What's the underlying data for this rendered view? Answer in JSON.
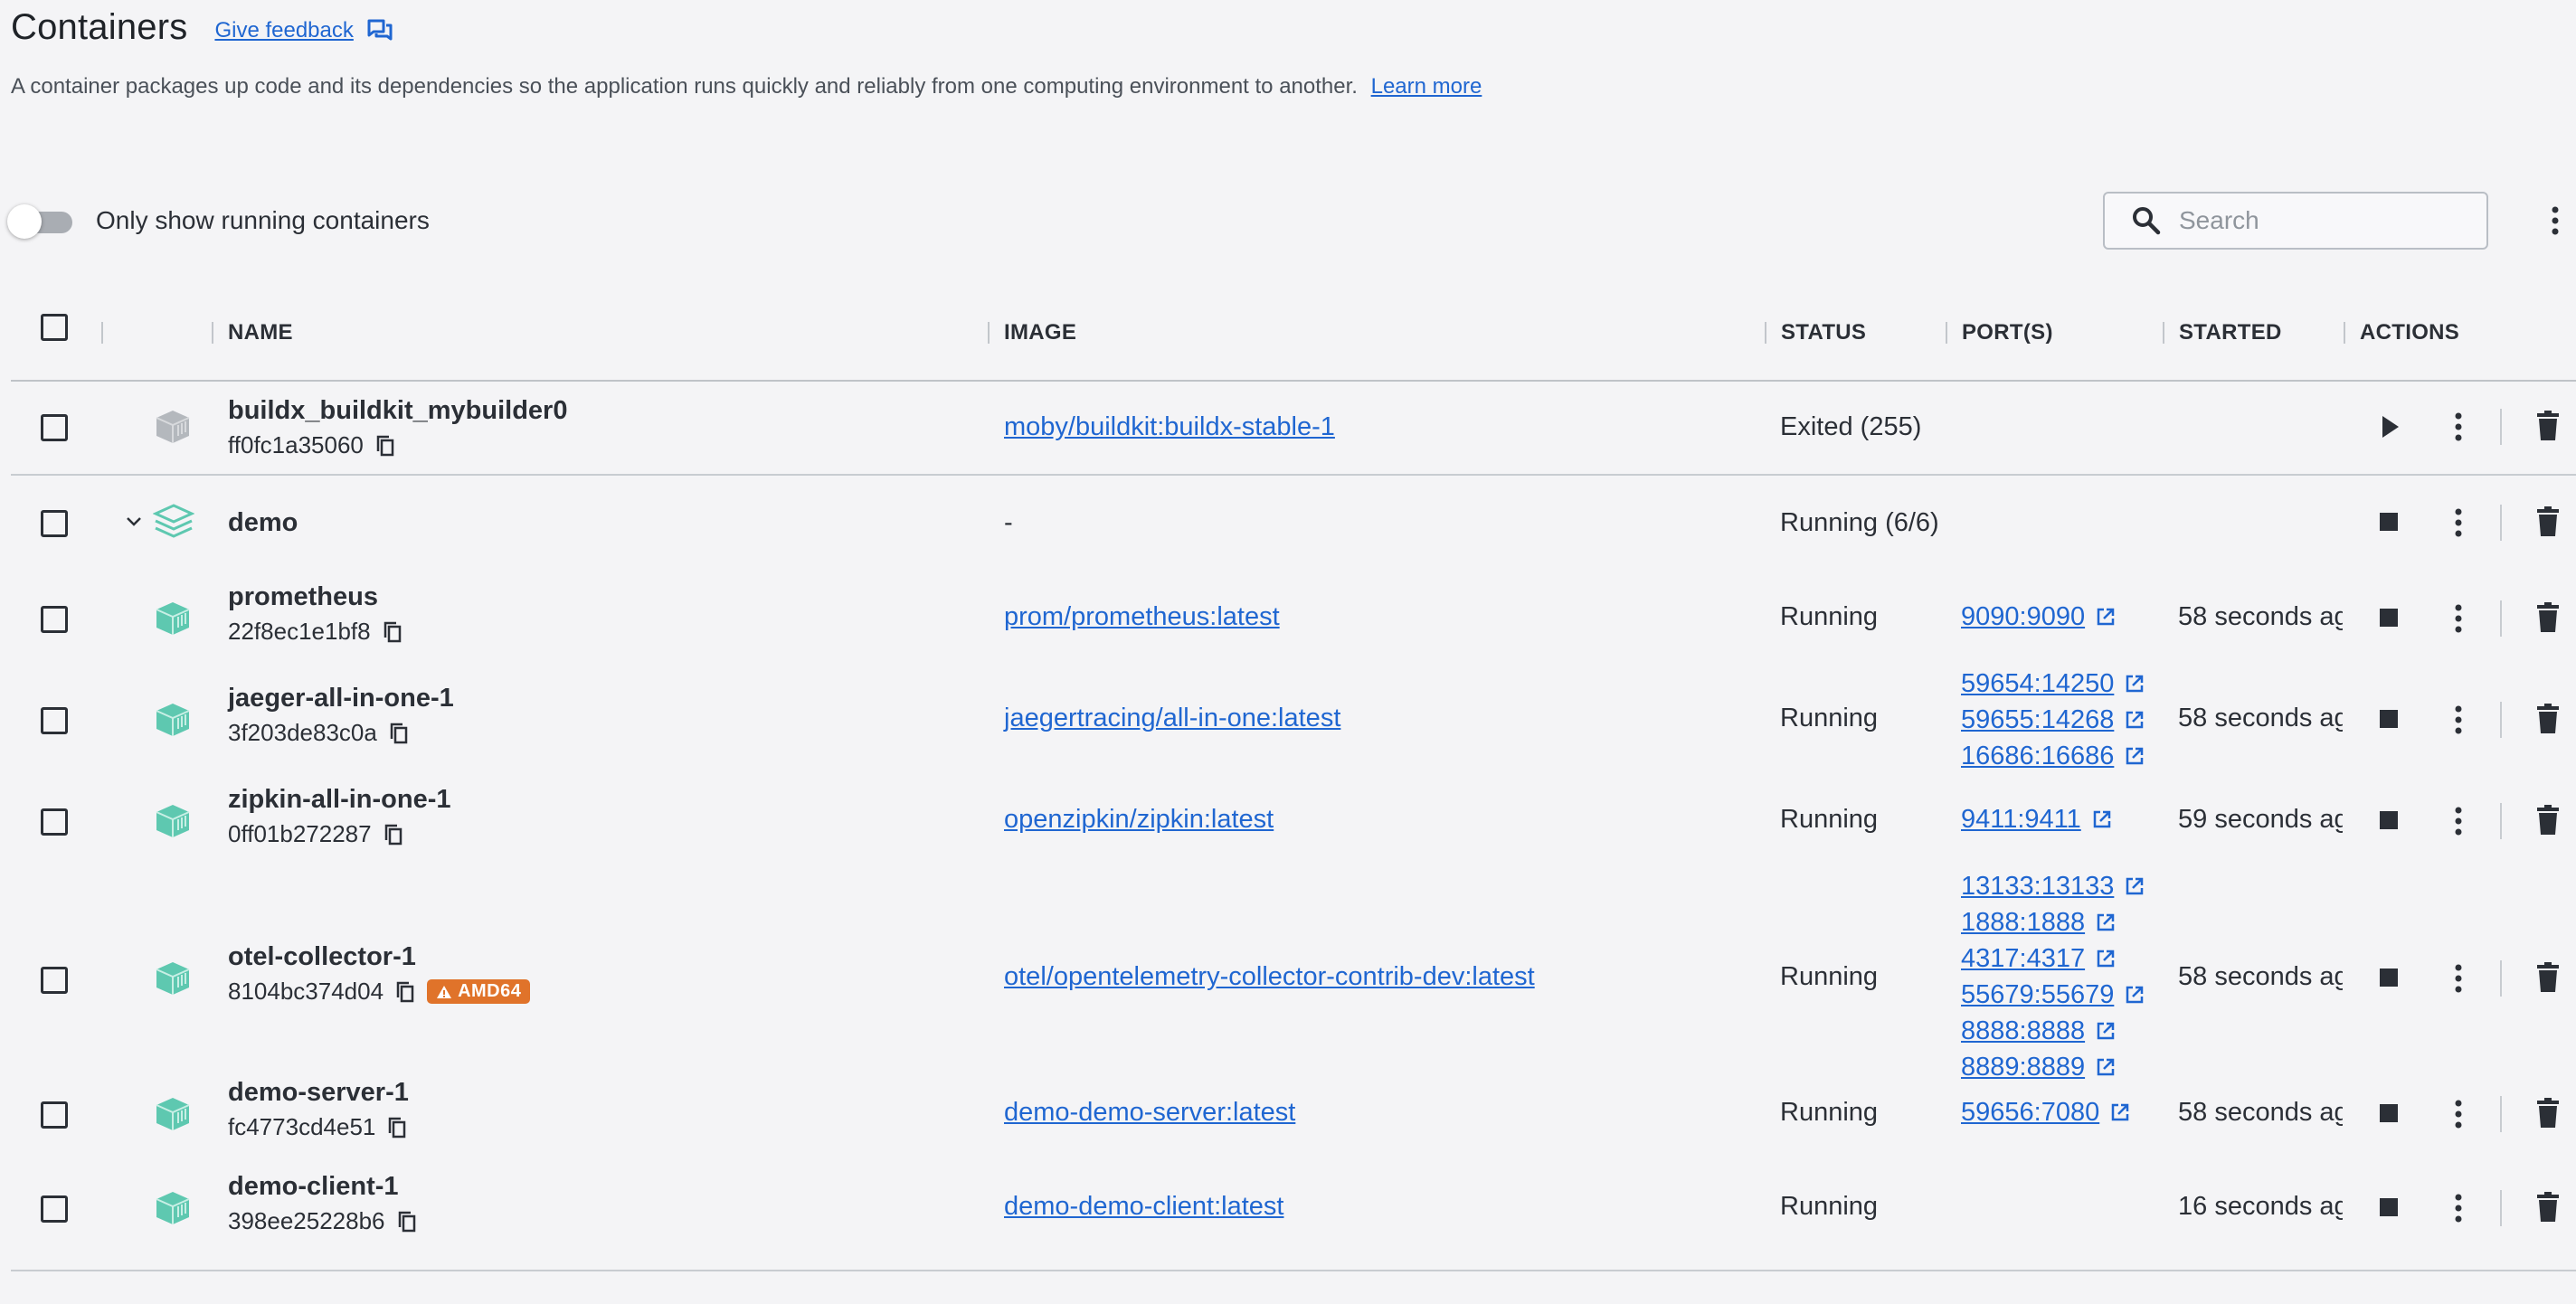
{
  "header": {
    "title": "Containers",
    "feedback_label": "Give feedback",
    "description": "A container packages up code and its dependencies so the application runs quickly and reliably from one computing environment to another.",
    "learn_more_label": "Learn more"
  },
  "toolbar": {
    "toggle_label": "Only show running containers",
    "toggle_on": false,
    "search_placeholder": "Search"
  },
  "columns": {
    "name": "NAME",
    "image": "IMAGE",
    "status": "STATUS",
    "ports": "PORT(S)",
    "started": "STARTED",
    "actions": "ACTIONS"
  },
  "colors": {
    "running_icon": "#5ec8b0",
    "exited_icon": "#b4b8bd",
    "link": "#1f66d1",
    "badge": "#e0732a"
  },
  "rows": [
    {
      "name": "buildx_buildkit_mybuilder0",
      "id": "ff0fc1a35060",
      "image": "moby/buildkit:buildx-stable-1",
      "status": "Exited (255)",
      "ports": [],
      "started": "",
      "icon": "container-exited-icon",
      "action": "play"
    },
    {
      "name": "demo",
      "id": "",
      "image": "-",
      "status": "Running (6/6)",
      "ports": [],
      "started": "",
      "icon": "compose-stack-icon",
      "action": "stop",
      "expanded": true
    },
    {
      "name": "prometheus",
      "id": "22f8ec1e1bf8",
      "image": "prom/prometheus:latest",
      "status": "Running",
      "ports": [
        "9090:9090"
      ],
      "started": "58 seconds ag",
      "icon": "container-running-icon",
      "action": "stop"
    },
    {
      "name": "jaeger-all-in-one-1",
      "id": "3f203de83c0a",
      "image": "jaegertracing/all-in-one:latest",
      "status": "Running",
      "ports": [
        "59654:14250",
        "59655:14268",
        "16686:16686"
      ],
      "started": "58 seconds ag",
      "icon": "container-running-icon",
      "action": "stop"
    },
    {
      "name": "zipkin-all-in-one-1",
      "id": "0ff01b272287",
      "image": "openzipkin/zipkin:latest",
      "status": "Running",
      "ports": [
        "9411:9411"
      ],
      "started": "59 seconds ag",
      "icon": "container-running-icon",
      "action": "stop"
    },
    {
      "name": "otel-collector-1",
      "id": "8104bc374d04",
      "badge": "AMD64",
      "image": "otel/opentelemetry-collector-contrib-dev:latest",
      "status": "Running",
      "ports": [
        "13133:13133",
        "1888:1888",
        "4317:4317",
        "55679:55679",
        "8888:8888",
        "8889:8889"
      ],
      "started": "58 seconds ag",
      "icon": "container-running-icon",
      "action": "stop"
    },
    {
      "name": "demo-server-1",
      "id": "fc4773cd4e51",
      "image": "demo-demo-server:latest",
      "status": "Running",
      "ports": [
        "59656:7080"
      ],
      "started": "58 seconds ag",
      "icon": "container-running-icon",
      "action": "stop"
    },
    {
      "name": "demo-client-1",
      "id": "398ee25228b6",
      "image": "demo-demo-client:latest",
      "status": "Running",
      "ports": [],
      "started": "16 seconds ag",
      "icon": "container-running-icon",
      "action": "stop"
    }
  ]
}
